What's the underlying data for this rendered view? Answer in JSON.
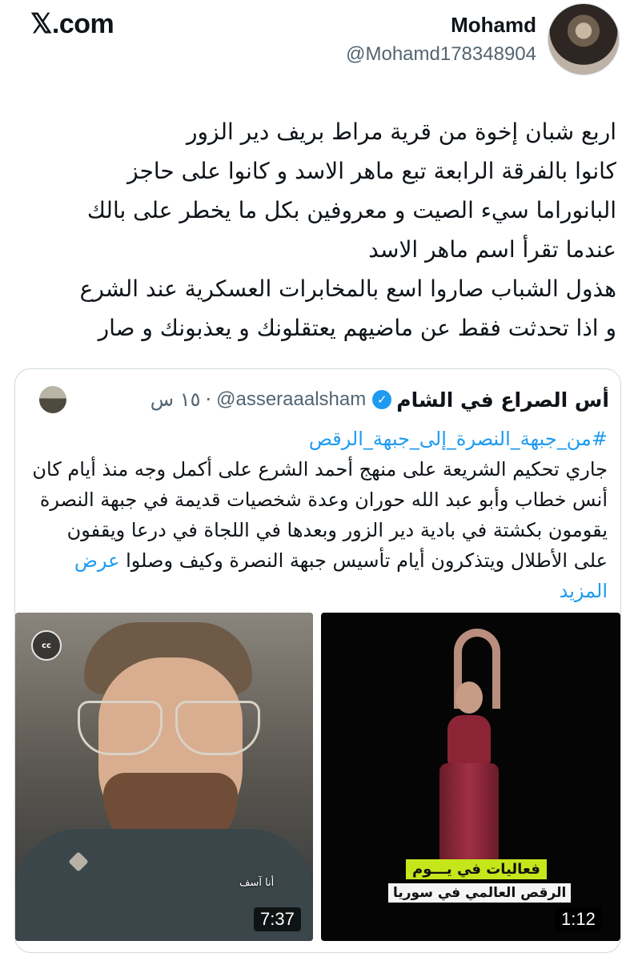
{
  "brand": {
    "logo_text": "𝕏.com"
  },
  "author": {
    "name": "Mohamd",
    "handle": "@Mohamd178348904"
  },
  "tweet": {
    "text": "اربع شبان إخوة من قرية مراط بريف دير الزور\nكانوا بالفرقة الرابعة تبع ماهر الاسد و كانوا على حاجز\nالبانوراما سيء الصيت و معروفين بكل ما يخطر على بالك\nعندما تقرأ اسم ماهر الاسد\nهذول الشباب صاروا اسع بالمخابرات العسكرية عند الشرع\nو اذا تحدثت فقط عن ماضيهم يعتقلونك و يعذبونك و صار"
  },
  "quote": {
    "author_name": "أس الصراع في الشام",
    "verified_icon": "✓",
    "handle": "@asseraaalsham",
    "time": "١٥ س",
    "hashtag": "#من_جبهة_النصرة_إلى_جبهة_الرقص",
    "body": "جاري تحكيم الشريعة على منهج أحمد الشرع على أكمل وجه منذ أيام كان أنس خطاب وأبو عبد الله حوران وعدة شخصيات قديمة في جبهة النصرة يقومون بكشتة في بادية دير الزور وبعدها في اللجاة في درعا ويقفون على الأطلال ويتذكرون أيام تأسيس جبهة النصرة وكيف وصلوا",
    "show_more": "عرض المزيد",
    "media": [
      {
        "badge": "cc",
        "caption": "أنا آسف",
        "duration": "7:37"
      },
      {
        "overlay_line1": "فعاليات في يـــوم",
        "overlay_line2": "الرقص العالمي في سوريا",
        "duration": "1:12"
      }
    ]
  },
  "colors": {
    "link": "#1d9bf0",
    "secondary_text": "#536471",
    "overlay_green": "#c6e61c"
  }
}
